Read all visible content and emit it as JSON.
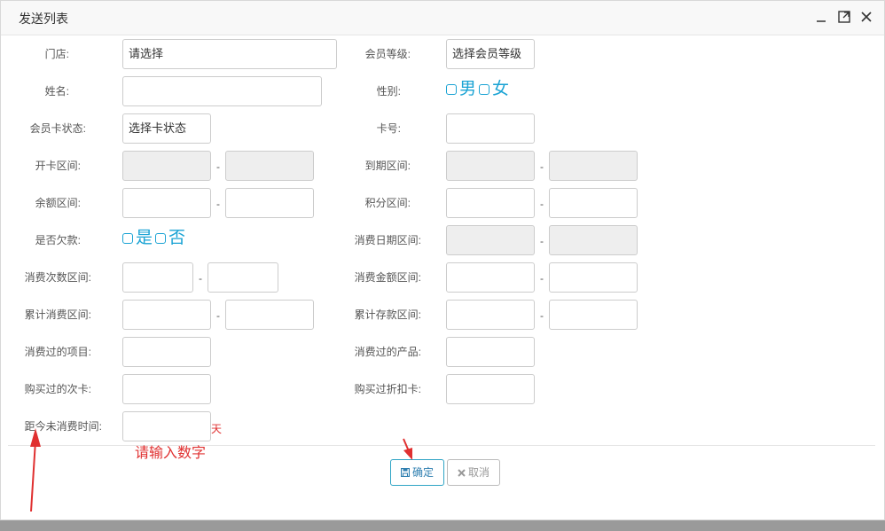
{
  "window": {
    "title": "发送列表"
  },
  "fields": {
    "store": {
      "label": "门店:",
      "value": "请选择"
    },
    "member_level": {
      "label": "会员等级:",
      "value": "选择会员等级"
    },
    "name": {
      "label": "姓名:"
    },
    "gender": {
      "label": "性别:",
      "options": [
        "男",
        "女"
      ]
    },
    "card_status": {
      "label": "会员卡状态:",
      "value": "选择卡状态"
    },
    "card_no": {
      "label": "卡号:"
    },
    "open_range": {
      "label": "开卡区间:"
    },
    "expire_range": {
      "label": "到期区间:"
    },
    "balance_range": {
      "label": "余额区间:"
    },
    "points_range": {
      "label": "积分区间:"
    },
    "in_debt": {
      "label": "是否欠款:",
      "options": [
        "是",
        "否"
      ]
    },
    "consume_date_range": {
      "label": "消费日期区间:"
    },
    "consume_count_range": {
      "label": "消费次数区间:"
    },
    "consume_amount_range": {
      "label": "消费金额区间:"
    },
    "total_consume_range": {
      "label": "累计消费区间:"
    },
    "total_deposit_range": {
      "label": "累计存款区间:"
    },
    "consumed_items": {
      "label": "消费过的项目:"
    },
    "consumed_products": {
      "label": "消费过的产品:"
    },
    "bought_times_card": {
      "label": "购买过的次卡:"
    },
    "bought_discount_card": {
      "label": "购买过折扣卡:"
    },
    "days_since_consume": {
      "label": "距今未消费时间:",
      "unit": "天"
    }
  },
  "range_separator": "-",
  "buttons": {
    "ok": "确定",
    "cancel": "取消"
  },
  "annotation": {
    "hint": "请输入数字"
  },
  "colors": {
    "accent": "#1aa3d4",
    "annotation": "#e03030"
  }
}
